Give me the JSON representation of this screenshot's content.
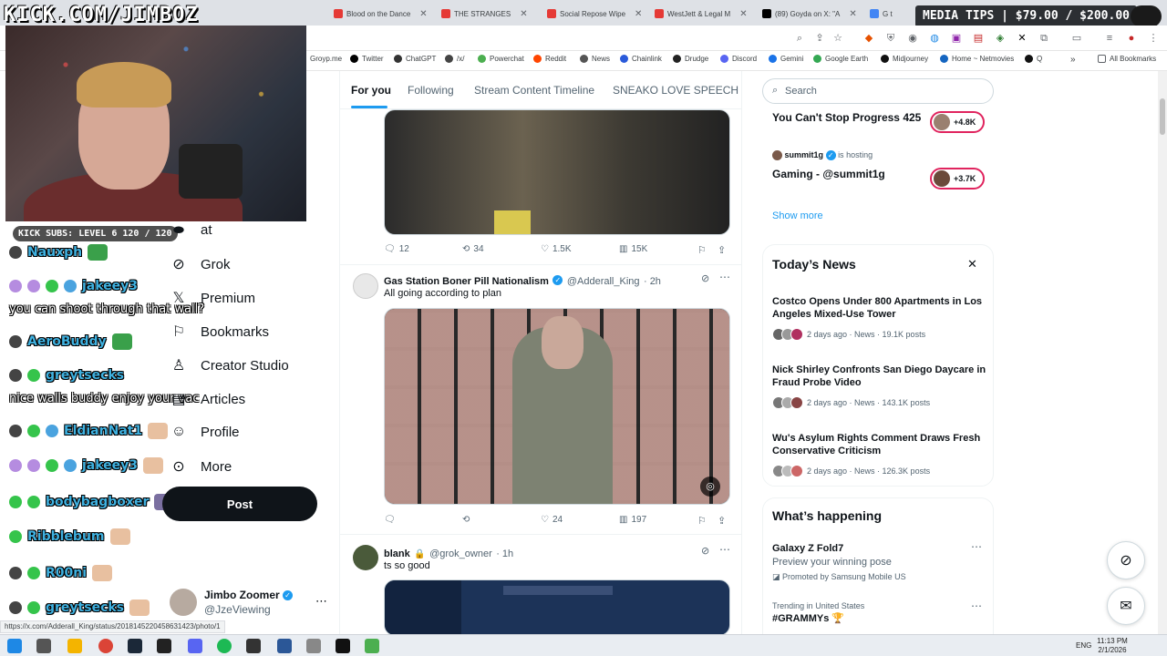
{
  "overlay": {
    "title": "KICK.COM/JIMBOZ",
    "media_tips": "MEDIA TIPS | $79.00 / $200.00",
    "kick_subs": "KICK SUBS: LEVEL 6 120 / 120"
  },
  "browser": {
    "tabs": [
      {
        "label": "Blood on the Dance",
        "color": "#e53935"
      },
      {
        "label": "THE STRANGES",
        "color": "#e53935"
      },
      {
        "label": "Social Repose Wipe",
        "color": "#e53935"
      },
      {
        "label": "WestJett & Legal M",
        "color": "#e53935"
      },
      {
        "label": "(89) Goyda on X: \"A",
        "color": "#000000"
      },
      {
        "label": "G t",
        "color": "#4285f4"
      }
    ],
    "bookmarks": [
      {
        "label": "Groyp.me",
        "color": "#888888"
      },
      {
        "label": "Twitter",
        "color": "#000000"
      },
      {
        "label": "ChatGPT",
        "color": "#333333"
      },
      {
        "label": "/x/",
        "color": "#444444"
      },
      {
        "label": "Powerchat",
        "color": "#4caf50"
      },
      {
        "label": "Reddit",
        "color": "#ff4500"
      },
      {
        "label": "News",
        "color": "#555555"
      },
      {
        "label": "Chainlink",
        "color": "#2a5ada"
      },
      {
        "label": "Drudge",
        "color": "#222222"
      },
      {
        "label": "Discord",
        "color": "#5865f2"
      },
      {
        "label": "Gemini",
        "color": "#1a73e8"
      },
      {
        "label": "Google Earth",
        "color": "#34a853"
      },
      {
        "label": "Midjourney",
        "color": "#111111"
      },
      {
        "label": "Home ~ Netmovies",
        "color": "#1565c0"
      },
      {
        "label": "Q",
        "color": "#111111"
      }
    ],
    "all_bookmarks": "All Bookmarks",
    "status_url": "https://x.com/Adderall_King/status/2018145220458631423/photo/1"
  },
  "chat": [
    {
      "name": "Nauxph",
      "msg": "",
      "badges": [
        "dark"
      ],
      "emote": true
    },
    {
      "name": "jakeey3",
      "msg": "",
      "badges": [
        "purple",
        "purple",
        "green",
        "blue"
      ],
      "emote": false
    },
    {
      "name": "",
      "msg": "you can shoot through that wall?",
      "badges": [],
      "emote": false
    },
    {
      "name": "AeroBuddy",
      "msg": "",
      "badges": [
        "dark"
      ],
      "emote": true
    },
    {
      "name": "greytsecks",
      "msg": "",
      "badges": [
        "dark",
        "green"
      ],
      "emote": false
    },
    {
      "name": "",
      "msg": "nice walls buddy enjoy your vac",
      "badges": [],
      "emote": false
    },
    {
      "name": "EldianNat1",
      "msg": "",
      "badges": [
        "dark",
        "green",
        "blue"
      ],
      "emote": true
    },
    {
      "name": "jakeey3",
      "msg": "",
      "badges": [
        "purple",
        "purple",
        "green",
        "blue"
      ],
      "emote": true
    },
    {
      "name": "bodybagboxer",
      "msg": "",
      "badges": [
        "green",
        "green"
      ],
      "emote": true
    },
    {
      "name": "Ribblebum",
      "msg": "",
      "badges": [
        "green"
      ],
      "emote": true
    },
    {
      "name": "R00ni",
      "msg": "",
      "badges": [
        "dark",
        "green"
      ],
      "emote": true
    },
    {
      "name": "greytsecks",
      "msg": "",
      "badges": [
        "dark",
        "green"
      ],
      "emote": true
    }
  ],
  "nav": {
    "items": [
      {
        "label": "at",
        "icon": "▬"
      },
      {
        "label": "Grok",
        "icon": "⊘"
      },
      {
        "label": "Premium",
        "icon": "X"
      },
      {
        "label": "Bookmarks",
        "icon": "🔖"
      },
      {
        "label": "Creator Studio",
        "icon": "♙"
      },
      {
        "label": "Articles",
        "icon": "▤"
      },
      {
        "label": "Profile",
        "icon": "👤"
      },
      {
        "label": "More",
        "icon": "⋯"
      }
    ],
    "post_label": "Post",
    "profile_name": "Jimbo Zoomer",
    "profile_handle": "@JzeViewing"
  },
  "feed": {
    "tabs": [
      "For you",
      "Following",
      "Stream Content Timeline",
      "SNEAKO LOVE SPEECH"
    ],
    "tweets": [
      {
        "name": "",
        "handle": "",
        "time": "",
        "text": "",
        "replies": "12",
        "reposts": "34",
        "likes": "1.5K",
        "views": "15K"
      },
      {
        "name": "Gas Station Boner Pill Nationalism",
        "handle": "@Adderall_King",
        "time": "· 2h",
        "text": "All going according to plan",
        "replies": "",
        "reposts": "",
        "likes": "24",
        "views": "197"
      },
      {
        "name": "blank",
        "handle": "@grok_owner",
        "time": "· 1h",
        "text": "ts so good",
        "replies": "",
        "reposts": "",
        "likes": "",
        "views": ""
      }
    ]
  },
  "sidebar": {
    "search_placeholder": "Search",
    "live": [
      {
        "host": "",
        "hosting": "",
        "title": "You Can't Stop Progress 425",
        "count": "+4.8K"
      },
      {
        "host": "summit1g",
        "hosting": "is hosting",
        "title": "Gaming - @summit1g",
        "count": "+3.7K"
      }
    ],
    "show_more": "Show more",
    "news_title": "Today’s News",
    "news": [
      {
        "title": "Costco Opens Under 800 Apartments in Los Angeles Mixed-Use Tower",
        "meta": "2 days ago · News · 19.1K posts"
      },
      {
        "title": "Nick Shirley Confronts San Diego Daycare in Fraud Probe Video",
        "meta": "2 days ago · News · 143.1K posts"
      },
      {
        "title": "Wu's Asylum Rights Comment Draws Fresh Conservative Criticism",
        "meta": "2 days ago · News · 126.3K posts"
      }
    ],
    "happening_title": "What’s happening",
    "happening": [
      {
        "title": "Galaxy Z Fold7",
        "sub": "Preview your winning pose",
        "promo": "Promoted by Samsung Mobile US"
      },
      {
        "title": "#GRAMMYs 🏆",
        "sub": "",
        "promo": "Trending in United States"
      }
    ]
  },
  "taskbar": {
    "lang": "ENG",
    "time": "11:13 PM",
    "date": "2/1/2026"
  }
}
